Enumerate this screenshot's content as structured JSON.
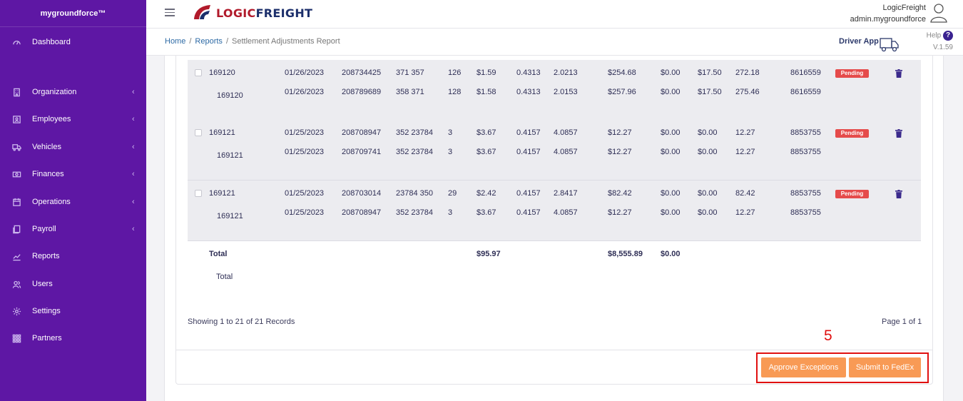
{
  "sidebar": {
    "brand": "mygroundforce™",
    "items": [
      {
        "label": "Dashboard",
        "icon": "dashboard-icon",
        "has_children": false
      },
      {
        "label": "Organization",
        "icon": "building-icon",
        "has_children": true
      },
      {
        "label": "Employees",
        "icon": "id-card-icon",
        "has_children": true
      },
      {
        "label": "Vehicles",
        "icon": "truck-icon",
        "has_children": true
      },
      {
        "label": "Finances",
        "icon": "money-icon",
        "has_children": true
      },
      {
        "label": "Operations",
        "icon": "calendar-icon",
        "has_children": true
      },
      {
        "label": "Payroll",
        "icon": "document-icon",
        "has_children": true
      },
      {
        "label": "Reports",
        "icon": "chart-line-icon",
        "has_children": false
      },
      {
        "label": "Users",
        "icon": "users-icon",
        "has_children": false
      },
      {
        "label": "Settings",
        "icon": "gear-icon",
        "has_children": false
      },
      {
        "label": "Partners",
        "icon": "grid-icon",
        "has_children": false
      }
    ],
    "chevron": "‹"
  },
  "header": {
    "logo_text_red": "LOGIC",
    "logo_text_blue": "FREIGHT",
    "company": "LogicFreight",
    "user": "admin.mygroundforce"
  },
  "breadcrumb": {
    "home": "Home",
    "reports": "Reports",
    "current": "Settlement Adjustments Report",
    "sep": "/"
  },
  "driver_app": "Driver App",
  "help": {
    "label": "Help",
    "icon": "?",
    "version": "V.1.59"
  },
  "table": {
    "groups": [
      {
        "rows": [
          {
            "id": "169120",
            "date": "01/26/2023",
            "tracking": "208734425",
            "route": "371 357",
            "qty": "126",
            "rate": "$1.59",
            "f1": "0.4313",
            "f2": "2.0213",
            "amount": "$254.68",
            "adj": "$0.00",
            "fee": "$17.50",
            "net": "272.18",
            "ref": "8616559"
          },
          {
            "id": "169120",
            "date": "01/26/2023",
            "tracking": "208789689",
            "route": "358 371",
            "qty": "128",
            "rate": "$1.58",
            "f1": "0.4313",
            "f2": "2.0153",
            "amount": "$257.96",
            "adj": "$0.00",
            "fee": "$17.50",
            "net": "275.46",
            "ref": "8616559"
          }
        ],
        "status": "Pending"
      },
      {
        "rows": [
          {
            "id": "169121",
            "date": "01/25/2023",
            "tracking": "208708947",
            "route": "352 23784",
            "qty": "3",
            "rate": "$3.67",
            "f1": "0.4157",
            "f2": "4.0857",
            "amount": "$12.27",
            "adj": "$0.00",
            "fee": "$0.00",
            "net": "12.27",
            "ref": "8853755"
          },
          {
            "id": "169121",
            "date": "01/25/2023",
            "tracking": "208709741",
            "route": "352 23784",
            "qty": "3",
            "rate": "$3.67",
            "f1": "0.4157",
            "f2": "4.0857",
            "amount": "$12.27",
            "adj": "$0.00",
            "fee": "$0.00",
            "net": "12.27",
            "ref": "8853755"
          }
        ],
        "status": "Pending"
      },
      {
        "rows": [
          {
            "id": "169121",
            "date": "01/25/2023",
            "tracking": "208703014",
            "route": "23784 350",
            "qty": "29",
            "rate": "$2.42",
            "f1": "0.4157",
            "f2": "2.8417",
            "amount": "$82.42",
            "adj": "$0.00",
            "fee": "$0.00",
            "net": "82.42",
            "ref": "8853755"
          },
          {
            "id": "169121",
            "date": "01/25/2023",
            "tracking": "208708947",
            "route": "352 23784",
            "qty": "3",
            "rate": "$3.67",
            "f1": "0.4157",
            "f2": "4.0857",
            "amount": "$12.27",
            "adj": "$0.00",
            "fee": "$0.00",
            "net": "12.27",
            "ref": "8853755"
          }
        ],
        "status": "Pending"
      }
    ],
    "total": {
      "label": "Total",
      "sub_label": "Total",
      "rate": "$95.97",
      "amount": "$8,555.89",
      "adj": "$0.00"
    }
  },
  "footer": {
    "showing": "Showing 1 to 21 of 21 Records",
    "page": "Page 1 of 1",
    "step_number": "5",
    "approve_label": "Approve Exceptions",
    "submit_label": "Submit to FedEx"
  },
  "colors": {
    "sidebar": "#5e17a4",
    "button": "#f89a55",
    "pending": "#e54b4b",
    "highlight": "#e01010"
  }
}
